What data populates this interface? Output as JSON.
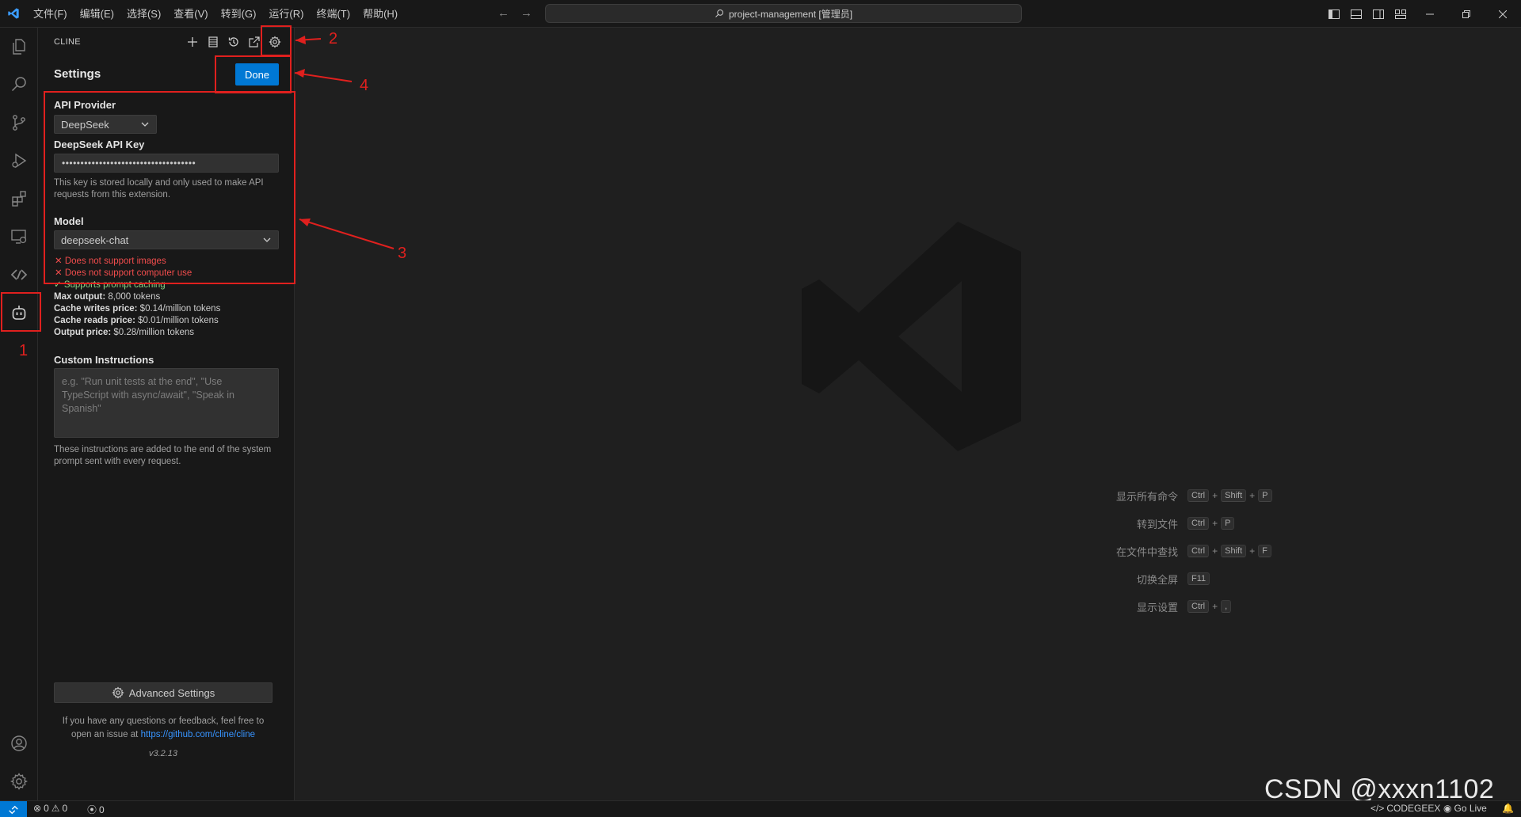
{
  "titlebar": {
    "menu": [
      "文件(F)",
      "编辑(E)",
      "选择(S)",
      "查看(V)",
      "转到(G)",
      "运行(R)",
      "终端(T)",
      "帮助(H)"
    ],
    "command_center": "project-management [管理员]",
    "back_icon": "arrow-left-icon",
    "forward_icon": "arrow-right-icon"
  },
  "sidebar": {
    "title": "CLINE",
    "settings_title": "Settings",
    "done_label": "Done",
    "api_provider_label": "API Provider",
    "api_provider_value": "DeepSeek",
    "api_key_label": "DeepSeek API Key",
    "api_key_value": "••••••••••••••••••••••••••••••••••••",
    "api_key_help": "This key is stored locally and only used to make API requests from this extension.",
    "model_label": "Model",
    "model_value": "deepseek-chat",
    "capabilities": [
      {
        "mark": "✕",
        "text": "Does not support images",
        "ok": false
      },
      {
        "mark": "✕",
        "text": "Does not support computer use",
        "ok": false
      },
      {
        "mark": "✓",
        "text": "Supports prompt caching",
        "ok": true
      }
    ],
    "pricing": [
      {
        "label": "Max output:",
        "value": "8,000 tokens"
      },
      {
        "label": "Cache writes price:",
        "value": "$0.14/million tokens"
      },
      {
        "label": "Cache reads price:",
        "value": "$0.01/million tokens"
      },
      {
        "label": "Output price:",
        "value": "$0.28/million tokens"
      }
    ],
    "custom_instructions_label": "Custom Instructions",
    "custom_instructions_placeholder": "e.g. \"Run unit tests at the end\", \"Use TypeScript with async/await\", \"Speak in Spanish\"",
    "custom_instructions_help": "These instructions are added to the end of the system prompt sent with every request.",
    "advanced_settings_label": "Advanced Settings",
    "footer_text": "If you have any questions or feedback, feel free to open an issue at",
    "footer_link": "https://github.com/cline/cline",
    "version": "v3.2.13"
  },
  "editor": {
    "shortcuts": [
      {
        "label": "显示所有命令",
        "keys": [
          "Ctrl",
          "Shift",
          "P"
        ]
      },
      {
        "label": "转到文件",
        "keys": [
          "Ctrl",
          "P"
        ]
      },
      {
        "label": "在文件中查找",
        "keys": [
          "Ctrl",
          "Shift",
          "F"
        ]
      },
      {
        "label": "切换全屏",
        "keys": [
          "F11"
        ]
      },
      {
        "label": "显示设置",
        "keys": [
          "Ctrl",
          ","
        ]
      }
    ]
  },
  "statusbar": {
    "errors": "0",
    "warnings": "0",
    "ports": "0",
    "codegeex": "CODEGEEX",
    "golive": "Go Live"
  },
  "annotations": {
    "n1": "1",
    "n2": "2",
    "n3": "3",
    "n4": "4",
    "color": "#e0201e"
  },
  "watermark": "CSDN @xxxn1102",
  "colors": {
    "accent": "#0078d4",
    "error": "#f14c4c",
    "success": "#89d185",
    "link": "#3794ff"
  }
}
